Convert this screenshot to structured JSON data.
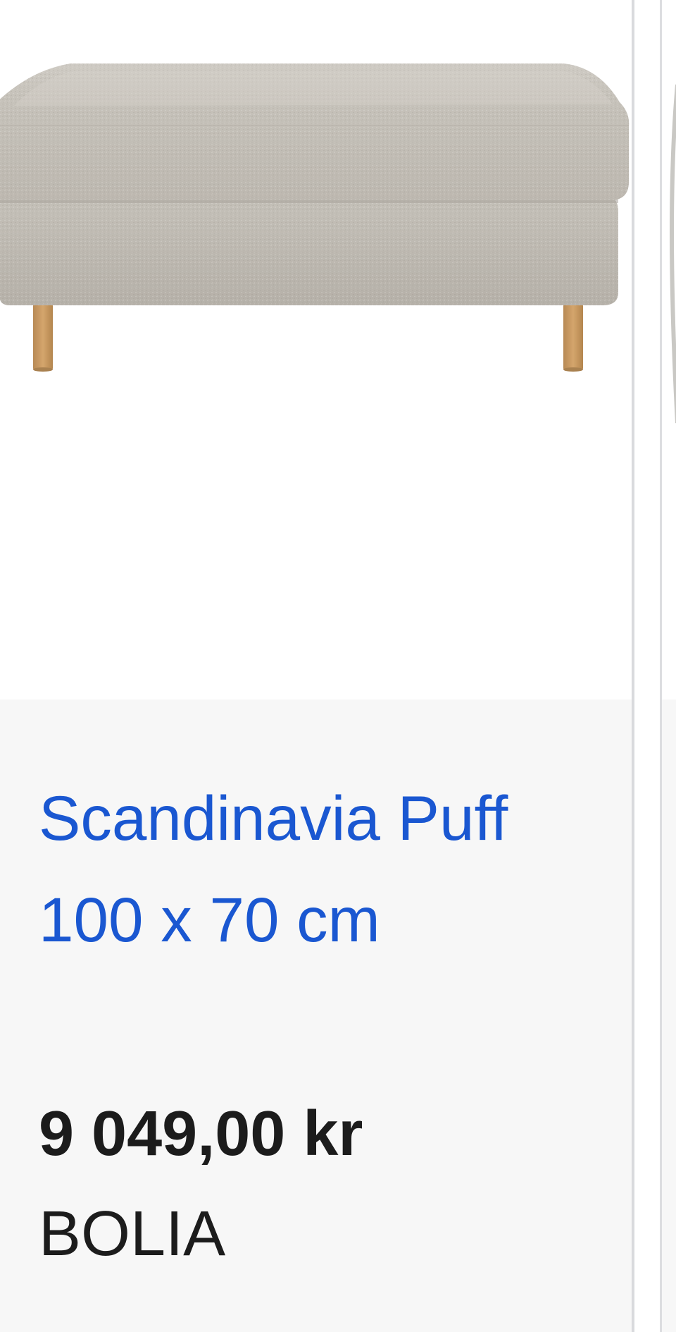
{
  "product": {
    "title": "Scandinavia Puff 100 x 70 cm",
    "price": "9 049,00 kr",
    "seller": "BOLIA",
    "image_icon": "ottoman-image",
    "upholstery_color": "#c8c4bd",
    "leg_color": "#c99a62"
  },
  "colors": {
    "title_link": "#1a57d1",
    "text": "#1c1c1c",
    "info_background": "#f7f7f7"
  }
}
